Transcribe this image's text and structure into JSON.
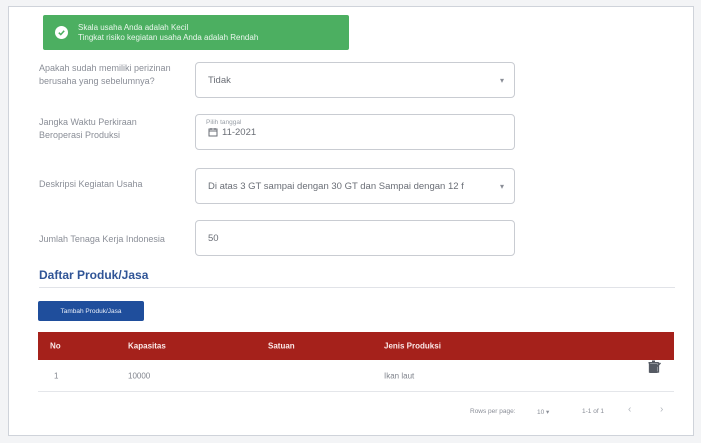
{
  "alert": {
    "line1": "Skala usaha Anda adalah Kecil",
    "line2": "Tingkat risiko kegiatan usaha Anda adalah Rendah"
  },
  "form": {
    "permit": {
      "label": "Apakah sudah memiliki perizinan berusaha yang sebelumnya?",
      "value": "Tidak"
    },
    "period": {
      "label": "Jangka Waktu Perkiraan Beroperasi Produksi",
      "floating": "Pilih tanggal",
      "value": "11-2021"
    },
    "capacity": {
      "label": "Deskripsi Kegiatan Usaha",
      "value": "Di atas 3 GT sampai dengan 30 GT dan Sampai dengan 12 f"
    },
    "workers": {
      "label": "Jumlah Tenaga Kerja Indonesia",
      "value": "50"
    }
  },
  "products": {
    "title": "Daftar Produk/Jasa",
    "add_label": "Tambah Produk/Jasa",
    "headers": [
      "No",
      "Kapasitas",
      "Satuan",
      "Jenis Produksi"
    ],
    "rows": [
      {
        "no": "1",
        "capacity": "10000",
        "unit": "",
        "type": "Ikan laut"
      }
    ],
    "pager": {
      "rows_label": "Rows per page:",
      "rows_value": "10",
      "range": "1-1 of 1"
    }
  },
  "icons": {
    "alert": "check-circle-icon",
    "edit": "edit-icon",
    "delete": "trash-icon",
    "calendar": "calendar-icon"
  },
  "colors": {
    "alert_bg": "#4caf61",
    "table_head": "#a5211b",
    "button": "#1f4e9c",
    "title": "#2f5496"
  }
}
